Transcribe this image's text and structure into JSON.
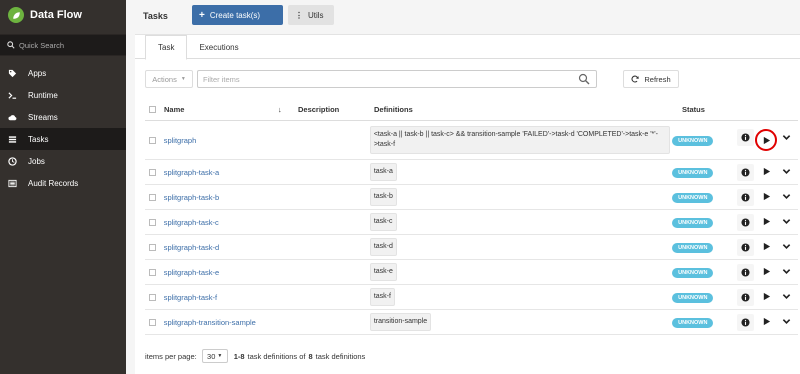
{
  "app": {
    "title": "Data Flow"
  },
  "sidebar": {
    "search_placeholder": "Quick Search",
    "items": [
      {
        "label": "Apps",
        "icon": "tag-icon"
      },
      {
        "label": "Runtime",
        "icon": "terminal-icon"
      },
      {
        "label": "Streams",
        "icon": "cloud-icon"
      },
      {
        "label": "Tasks",
        "icon": "tasks-icon"
      },
      {
        "label": "Jobs",
        "icon": "clock-icon"
      },
      {
        "label": "Audit Records",
        "icon": "list-icon"
      }
    ],
    "active": "Tasks"
  },
  "header": {
    "title": "Tasks",
    "create_label": "Create task(s)",
    "utils_label": "Utils"
  },
  "tabs": [
    {
      "label": "Task"
    },
    {
      "label": "Executions"
    }
  ],
  "toolbar": {
    "actions_label": "Actions",
    "filter_placeholder": "Filter items",
    "refresh_label": "Refresh"
  },
  "table": {
    "columns": {
      "name": "Name",
      "description": "Description",
      "definitions": "Definitions",
      "status": "Status"
    },
    "rows": [
      {
        "name": "splitgraph",
        "description": "",
        "definition": "<task-a || task-b || task-c> && transition-sample 'FAILED'->task-d 'COMPLETED'->task-e '*'->task-f",
        "status": "UNKNOWN"
      },
      {
        "name": "splitgraph-task-a",
        "description": "",
        "definition": "task-a",
        "status": "UNKNOWN"
      },
      {
        "name": "splitgraph-task-b",
        "description": "",
        "definition": "task-b",
        "status": "UNKNOWN"
      },
      {
        "name": "splitgraph-task-c",
        "description": "",
        "definition": "task-c",
        "status": "UNKNOWN"
      },
      {
        "name": "splitgraph-task-d",
        "description": "",
        "definition": "task-d",
        "status": "UNKNOWN"
      },
      {
        "name": "splitgraph-task-e",
        "description": "",
        "definition": "task-e",
        "status": "UNKNOWN"
      },
      {
        "name": "splitgraph-task-f",
        "description": "",
        "definition": "task-f",
        "status": "UNKNOWN"
      },
      {
        "name": "splitgraph-transition-sample",
        "description": "",
        "definition": "transition-sample",
        "status": "UNKNOWN"
      }
    ]
  },
  "footer": {
    "items_per_page_label": "items per page:",
    "page_size": "30",
    "range": "1-8",
    "summary_text": "task definitions of",
    "total": "8",
    "summary_suffix": "task definitions"
  },
  "colors": {
    "accent": "#3c6ea8",
    "sidebar_bg": "#34302d",
    "badge": "#5bc0de",
    "highlight": "#e00000",
    "brand": "#6db33f"
  }
}
